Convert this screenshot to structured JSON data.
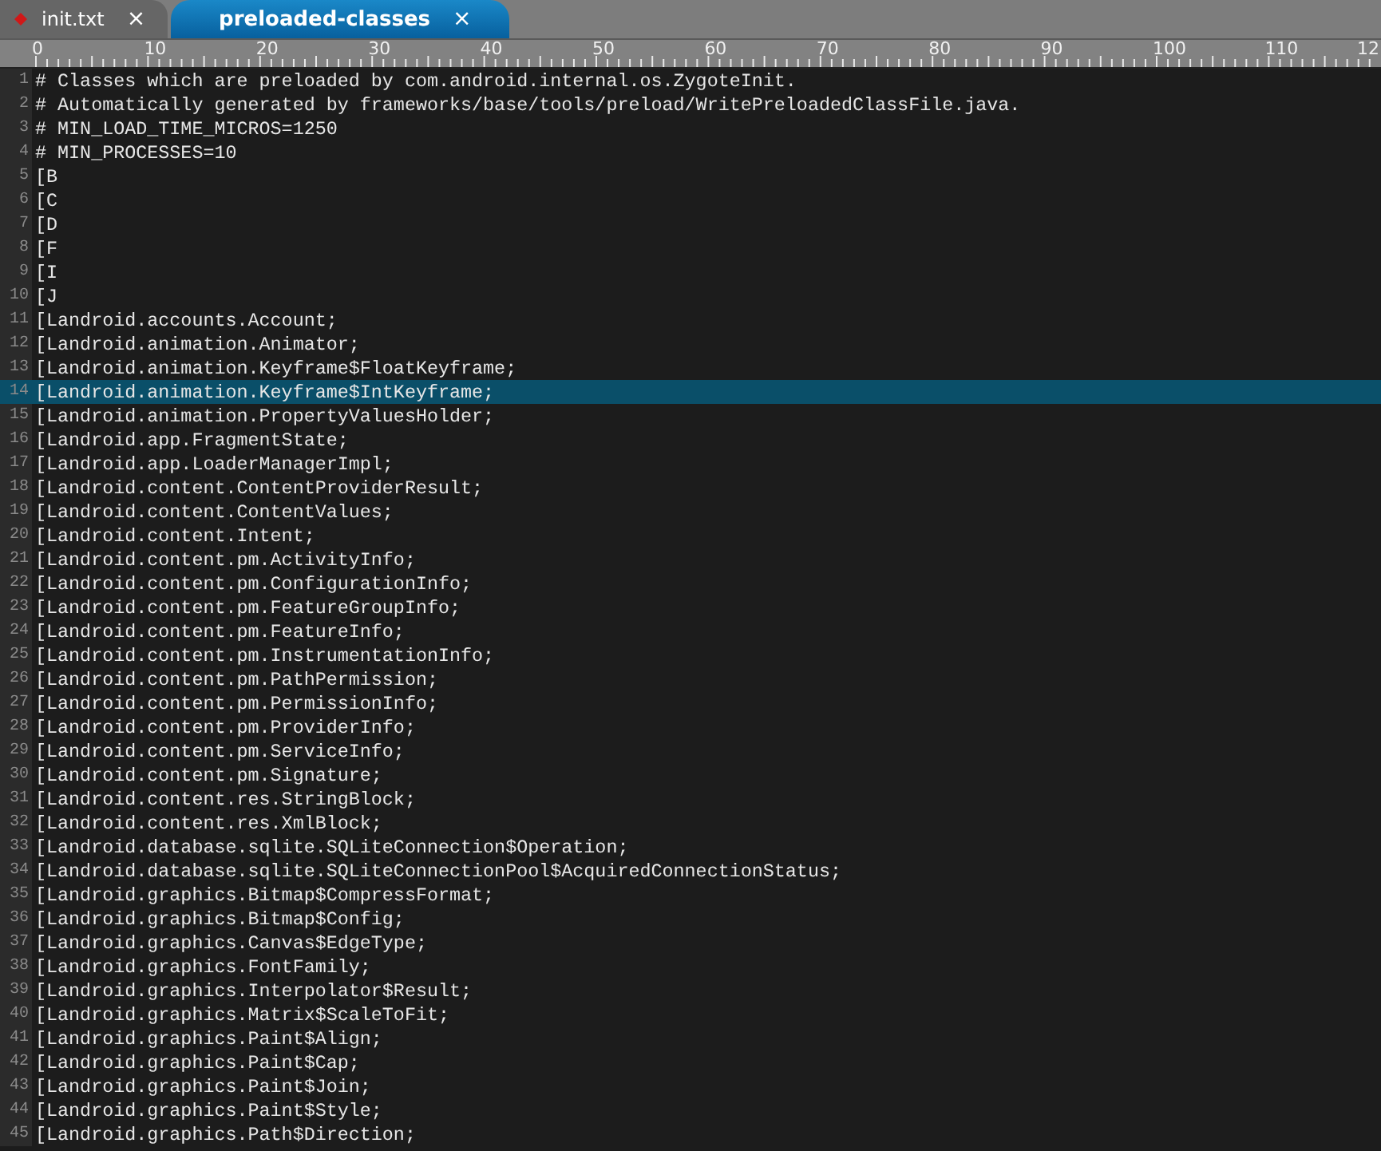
{
  "tabs": [
    {
      "label": "init.txt",
      "selected": false,
      "modified": true,
      "close": "×"
    },
    {
      "label": "preloaded-classes",
      "selected": true,
      "modified": false,
      "close": "×"
    }
  ],
  "ruler": {
    "labels": [
      "0",
      "10",
      "20",
      "30",
      "40",
      "50",
      "60",
      "70",
      "80",
      "90",
      "100",
      "110",
      "12"
    ]
  },
  "lines": [
    {
      "number": "1",
      "text": "# Classes which are preloaded by com.android.internal.os.ZygoteInit.",
      "selected": false
    },
    {
      "number": "2",
      "text": "# Automatically generated by frameworks/base/tools/preload/WritePreloadedClassFile.java.",
      "selected": false
    },
    {
      "number": "3",
      "text": "# MIN_LOAD_TIME_MICROS=1250",
      "selected": false
    },
    {
      "number": "4",
      "text": "# MIN_PROCESSES=10",
      "selected": false
    },
    {
      "number": "5",
      "text": "[B",
      "selected": false
    },
    {
      "number": "6",
      "text": "[C",
      "selected": false
    },
    {
      "number": "7",
      "text": "[D",
      "selected": false
    },
    {
      "number": "8",
      "text": "[F",
      "selected": false
    },
    {
      "number": "9",
      "text": "[I",
      "selected": false
    },
    {
      "number": "10",
      "text": "[J",
      "selected": false
    },
    {
      "number": "11",
      "text": "[Landroid.accounts.Account;",
      "selected": false
    },
    {
      "number": "12",
      "text": "[Landroid.animation.Animator;",
      "selected": false
    },
    {
      "number": "13",
      "text": "[Landroid.animation.Keyframe$FloatKeyframe;",
      "selected": false
    },
    {
      "number": "14",
      "text": "[Landroid.animation.Keyframe$IntKeyframe;",
      "selected": true
    },
    {
      "number": "15",
      "text": "[Landroid.animation.PropertyValuesHolder;",
      "selected": false
    },
    {
      "number": "16",
      "text": "[Landroid.app.FragmentState;",
      "selected": false
    },
    {
      "number": "17",
      "text": "[Landroid.app.LoaderManagerImpl;",
      "selected": false
    },
    {
      "number": "18",
      "text": "[Landroid.content.ContentProviderResult;",
      "selected": false
    },
    {
      "number": "19",
      "text": "[Landroid.content.ContentValues;",
      "selected": false
    },
    {
      "number": "20",
      "text": "[Landroid.content.Intent;",
      "selected": false
    },
    {
      "number": "21",
      "text": "[Landroid.content.pm.ActivityInfo;",
      "selected": false
    },
    {
      "number": "22",
      "text": "[Landroid.content.pm.ConfigurationInfo;",
      "selected": false
    },
    {
      "number": "23",
      "text": "[Landroid.content.pm.FeatureGroupInfo;",
      "selected": false
    },
    {
      "number": "24",
      "text": "[Landroid.content.pm.FeatureInfo;",
      "selected": false
    },
    {
      "number": "25",
      "text": "[Landroid.content.pm.InstrumentationInfo;",
      "selected": false
    },
    {
      "number": "26",
      "text": "[Landroid.content.pm.PathPermission;",
      "selected": false
    },
    {
      "number": "27",
      "text": "[Landroid.content.pm.PermissionInfo;",
      "selected": false
    },
    {
      "number": "28",
      "text": "[Landroid.content.pm.ProviderInfo;",
      "selected": false
    },
    {
      "number": "29",
      "text": "[Landroid.content.pm.ServiceInfo;",
      "selected": false
    },
    {
      "number": "30",
      "text": "[Landroid.content.pm.Signature;",
      "selected": false
    },
    {
      "number": "31",
      "text": "[Landroid.content.res.StringBlock;",
      "selected": false
    },
    {
      "number": "32",
      "text": "[Landroid.content.res.XmlBlock;",
      "selected": false
    },
    {
      "number": "33",
      "text": "[Landroid.database.sqlite.SQLiteConnection$Operation;",
      "selected": false
    },
    {
      "number": "34",
      "text": "[Landroid.database.sqlite.SQLiteConnectionPool$AcquiredConnectionStatus;",
      "selected": false
    },
    {
      "number": "35",
      "text": "[Landroid.graphics.Bitmap$CompressFormat;",
      "selected": false
    },
    {
      "number": "36",
      "text": "[Landroid.graphics.Bitmap$Config;",
      "selected": false
    },
    {
      "number": "37",
      "text": "[Landroid.graphics.Canvas$EdgeType;",
      "selected": false
    },
    {
      "number": "38",
      "text": "[Landroid.graphics.FontFamily;",
      "selected": false
    },
    {
      "number": "39",
      "text": "[Landroid.graphics.Interpolator$Result;",
      "selected": false
    },
    {
      "number": "40",
      "text": "[Landroid.graphics.Matrix$ScaleToFit;",
      "selected": false
    },
    {
      "number": "41",
      "text": "[Landroid.graphics.Paint$Align;",
      "selected": false
    },
    {
      "number": "42",
      "text": "[Landroid.graphics.Paint$Cap;",
      "selected": false
    },
    {
      "number": "43",
      "text": "[Landroid.graphics.Paint$Join;",
      "selected": false
    },
    {
      "number": "44",
      "text": "[Landroid.graphics.Paint$Style;",
      "selected": false
    },
    {
      "number": "45",
      "text": "[Landroid.graphics.Path$Direction;",
      "selected": false
    }
  ]
}
